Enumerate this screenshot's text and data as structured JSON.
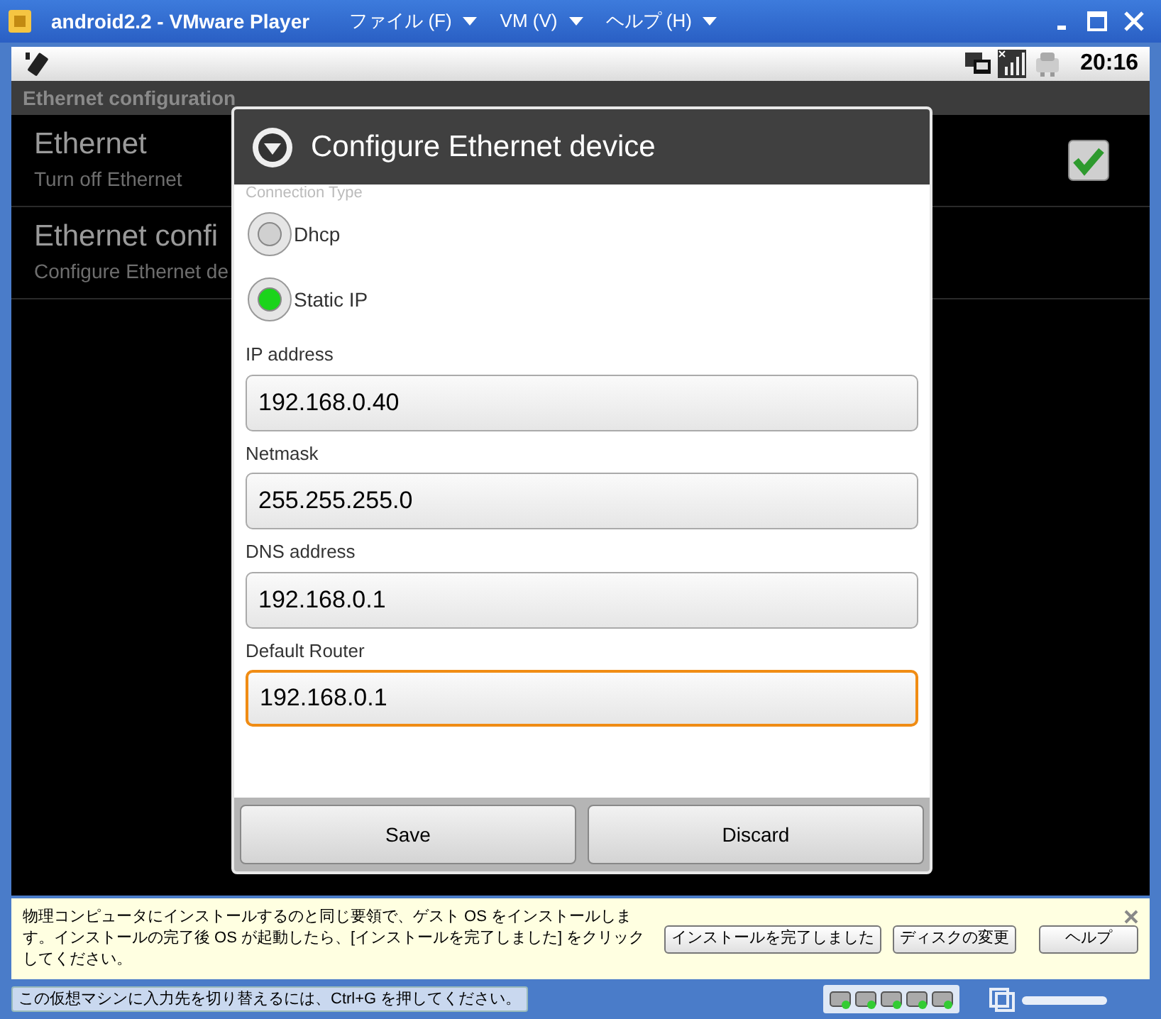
{
  "window": {
    "title": "android2.2 - VMware Player",
    "menus": [
      {
        "label": "ファイル (F)"
      },
      {
        "label": "VM (V)"
      },
      {
        "label": "ヘルプ (H)"
      }
    ]
  },
  "android": {
    "status_bar": {
      "time": "20:16"
    },
    "screen_title": "Ethernet configuration",
    "settings": [
      {
        "kind": "checkbox",
        "title": "Ethernet",
        "summary": "Turn off Ethernet",
        "checked": true
      },
      {
        "kind": "plain",
        "title": "Ethernet confi",
        "summary": "Configure Ethernet de"
      }
    ]
  },
  "dialog": {
    "title": "Configure Ethernet device",
    "section_label": "Connection Type",
    "radios": [
      {
        "label": "Dhcp",
        "selected": false
      },
      {
        "label": "Static IP",
        "selected": true
      }
    ],
    "fields": [
      {
        "label": "IP address",
        "value": "192.168.0.40",
        "focused": false
      },
      {
        "label": "Netmask",
        "value": "255.255.255.0",
        "focused": false
      },
      {
        "label": "DNS address",
        "value": "192.168.0.1",
        "focused": false
      },
      {
        "label": "Default Router",
        "value": "192.168.0.1",
        "focused": true
      }
    ],
    "buttons": [
      "Save",
      "Discard"
    ]
  },
  "info_bar": {
    "message": "物理コンピュータにインストールするのと同じ要領で、ゲスト OS をインストールします。インストールの完了後 OS が起動したら、[インストールを完了しました] をクリックしてください。",
    "buttons": [
      "インストールを完了しました",
      "ディスクの変更",
      "ヘルプ"
    ]
  },
  "status_bar": {
    "text": "この仮想マシンに入力先を切り替えるには、Ctrl+G を押してください。"
  }
}
